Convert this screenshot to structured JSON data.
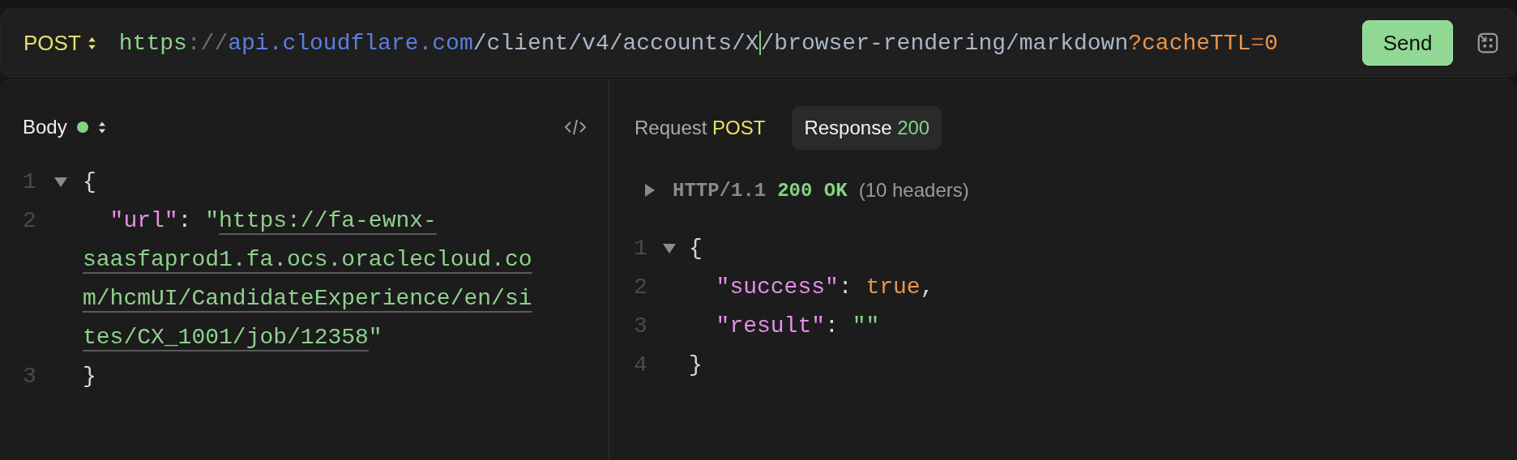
{
  "request_bar": {
    "method": "POST",
    "url": [
      {
        "kind": "scheme",
        "text": "https"
      },
      {
        "kind": "separator",
        "text": "://"
      },
      {
        "kind": "host",
        "text": "api.cloudflare.com"
      },
      {
        "kind": "path",
        "text": "/client/v4/accounts/X"
      },
      {
        "kind": "cursor"
      },
      {
        "kind": "path",
        "text": "/browser-rendering/markdown"
      },
      {
        "kind": "query",
        "text": "?cacheTTL"
      },
      {
        "kind": "separator_query",
        "text": "="
      },
      {
        "kind": "query",
        "text": "0"
      }
    ],
    "send_button": "Send"
  },
  "body_panel": {
    "title": "Body",
    "lines": [
      {
        "number": "1",
        "expanded": true,
        "tokens": [
          {
            "kind": "punct",
            "text": "{"
          }
        ],
        "children": [
          {
            "number": "2",
            "tokens": [
              {
                "kind": "key",
                "text": "\"url\""
              },
              {
                "kind": "punct",
                "text": ": "
              },
              {
                "kind": "string",
                "text": "\""
              },
              {
                "kind": "link",
                "text": "https://fa-ewnx-"
              }
            ],
            "wrapped_rows": [
              [
                {
                  "kind": "link",
                  "text": "saasfaprod1.fa.ocs.oraclecloud.co"
                }
              ],
              [
                {
                  "kind": "link",
                  "text": "m/hcmUI/CandidateExperience/en/si"
                }
              ],
              [
                {
                  "kind": "link",
                  "text": "tes/CX_1001/job/12358"
                },
                {
                  "kind": "string",
                  "text": "\""
                }
              ]
            ]
          }
        ]
      },
      {
        "number": "3",
        "tokens": [
          {
            "kind": "punct",
            "text": "}"
          }
        ]
      }
    ]
  },
  "response_panel": {
    "tabs": [
      {
        "label": "Request",
        "badge": "POST",
        "color": "#e6e06a",
        "selected": false
      },
      {
        "label": "Response",
        "badge": "200",
        "color": "#84d383",
        "selected": true
      }
    ],
    "status_line": {
      "expanded": false,
      "protocol": "HTTP/1.1",
      "status": "200 OK",
      "headers": "(10 headers)"
    },
    "lines": [
      {
        "number": "1",
        "expanded": true,
        "tokens": [
          {
            "kind": "punct",
            "text": "{"
          }
        ],
        "children": [
          {
            "number": "2",
            "tokens": [
              {
                "kind": "key",
                "text": "\"success\""
              },
              {
                "kind": "punct",
                "text": ": "
              },
              {
                "kind": "literal",
                "text": "true"
              },
              {
                "kind": "punct",
                "text": ","
              }
            ]
          },
          {
            "number": "3",
            "tokens": [
              {
                "kind": "key",
                "text": "\"result\""
              },
              {
                "kind": "punct",
                "text": ": "
              },
              {
                "kind": "string",
                "text": "\"\""
              }
            ]
          }
        ]
      },
      {
        "number": "4",
        "tokens": [
          {
            "kind": "punct",
            "text": "}"
          }
        ]
      }
    ]
  }
}
